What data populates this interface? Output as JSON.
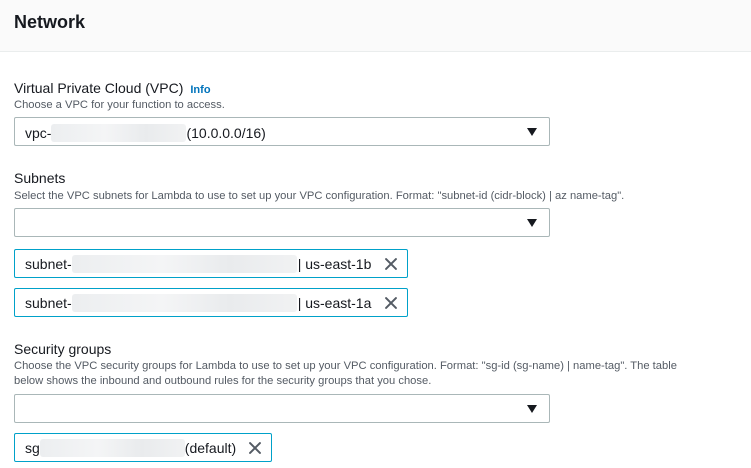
{
  "section": {
    "title": "Network"
  },
  "vpc": {
    "label": "Virtual Private Cloud (VPC)",
    "info_link": "Info",
    "description": "Choose a VPC for your function to access.",
    "selected_prefix": "vpc-",
    "selected_suffix": "(10.0.0.0/16)"
  },
  "subnets": {
    "label": "Subnets",
    "description": "Select the VPC subnets for Lambda to use to set up your VPC configuration. Format: \"subnet-id (cidr-block) | az name-tag\".",
    "select_value": "",
    "tokens": [
      {
        "prefix": "subnet-",
        "suffix": "| us-east-1b"
      },
      {
        "prefix": "subnet-",
        "suffix": "| us-east-1a"
      }
    ]
  },
  "security_groups": {
    "label": "Security groups",
    "description_line1": "Choose the VPC security groups for Lambda to use to set up your VPC configuration. Format: \"sg-id (sg-name) | name-tag\". The table",
    "description_line2": "below shows the inbound and outbound rules for the security groups that you chose.",
    "select_value": "",
    "tokens": [
      {
        "prefix": "sg",
        "suffix": "(default)"
      }
    ]
  },
  "icons": {
    "caret": "caret-down-icon",
    "remove": "close-icon"
  }
}
